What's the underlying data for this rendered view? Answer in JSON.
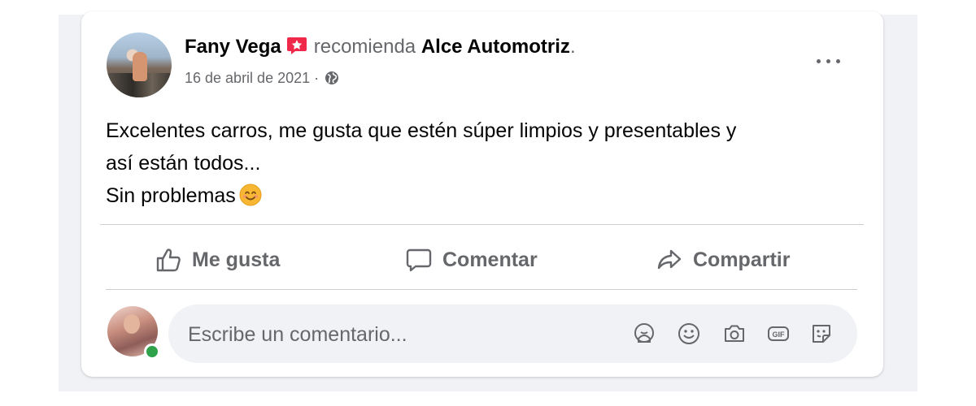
{
  "post": {
    "author": "Fany Vega",
    "verb": "recomienda",
    "page_name": "Alce Automotriz",
    "page_suffix": ".",
    "date": "16 de abril de 2021",
    "date_separator": " · ",
    "privacy_icon": "globe-icon",
    "badge_icon": "recommendation-star-icon",
    "text_lines": [
      "Excelentes carros, me gusta que estén súper limpios y presentables y",
      "así están todos...",
      "Sin problemas"
    ],
    "text_emoji": "smiling-face-emoji"
  },
  "actions": {
    "like_label": "Me gusta",
    "comment_label": "Comentar",
    "share_label": "Compartir"
  },
  "comment_box": {
    "placeholder": "Escribe un comentario...",
    "icons": [
      "avatar-sticker-icon",
      "emoji-icon",
      "camera-icon",
      "gif-icon",
      "sticker-icon"
    ]
  },
  "colors": {
    "badge": "#f02849",
    "online": "#31a24c",
    "secondary_text": "#65676b",
    "primary_text": "#050505"
  }
}
